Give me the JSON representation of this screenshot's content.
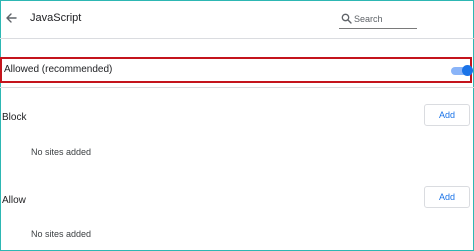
{
  "header": {
    "title": "JavaScript",
    "search": {
      "placeholder": "Search"
    }
  },
  "allowed": {
    "label": "Allowed (recommended)",
    "toggle_on": true
  },
  "block": {
    "label": "Block",
    "add_label": "Add",
    "empty_text": "No sites added"
  },
  "allow": {
    "label": "Allow",
    "add_label": "Add",
    "empty_text": "No sites added"
  },
  "colors": {
    "accent": "#1a73e8",
    "toggle_track": "#8ab4f8",
    "highlight_border": "#c4141c",
    "frame_border": "#2db7b3"
  },
  "icons": {
    "back": "arrow-back-icon",
    "search": "search-icon"
  }
}
